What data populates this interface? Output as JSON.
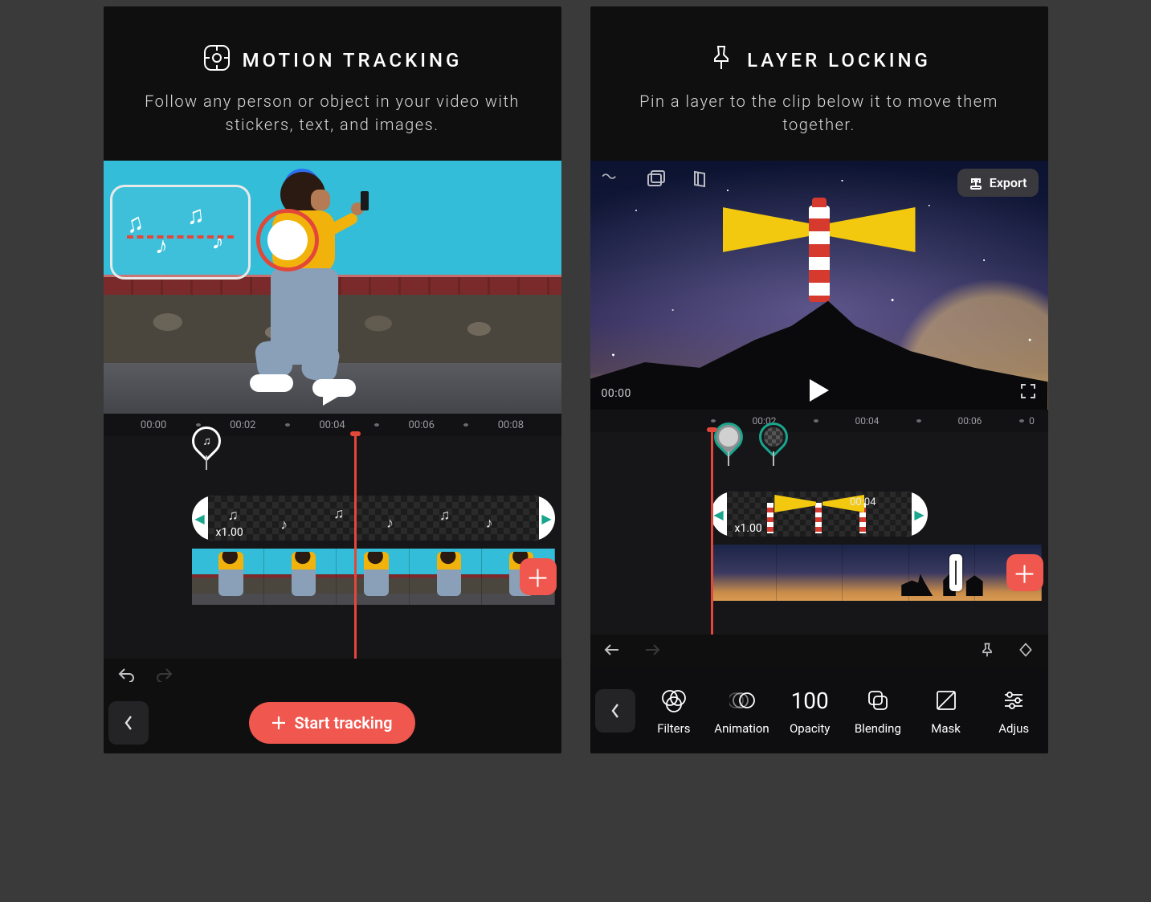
{
  "panels": {
    "motion": {
      "title": "MOTION TRACKING",
      "subtitle": "Follow any person or object in your video with stickers, text, and images.",
      "ruler": [
        "00:00",
        "00:02",
        "00:04",
        "00:06",
        "00:08"
      ],
      "clip_speed": "x1.00",
      "start_button": "Start tracking",
      "playhead_near": "00:04"
    },
    "layer": {
      "title": "LAYER LOCKING",
      "subtitle": "Pin a layer to the clip below it to move them together.",
      "export_label": "Export",
      "preview_tc": "00:00",
      "ruler": [
        "00:02",
        "00:04",
        "00:06",
        "0"
      ],
      "clip_speed": "x1.00",
      "clip_tc": "00:04",
      "tools": [
        {
          "key": "filters",
          "label": "Filters"
        },
        {
          "key": "animation",
          "label": "Animation"
        },
        {
          "key": "opacity",
          "label": "Opacity",
          "value": "100"
        },
        {
          "key": "blending",
          "label": "Blending"
        },
        {
          "key": "mask",
          "label": "Mask"
        },
        {
          "key": "adjust",
          "label": "Adjus"
        }
      ]
    }
  },
  "colors": {
    "accent_red": "#f0574e",
    "playhead": "#e2473a",
    "teal": "#1aa58d",
    "beam": "#f2c90f"
  }
}
